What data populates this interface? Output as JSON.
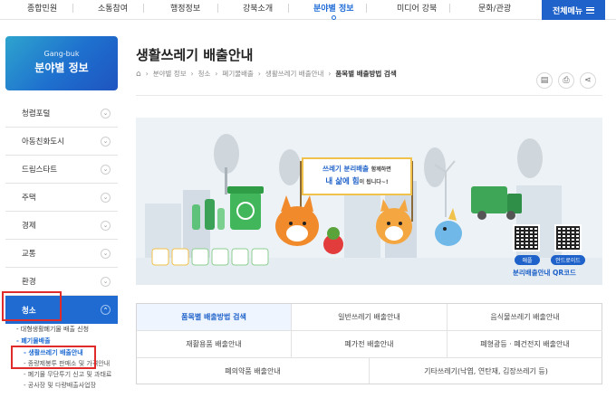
{
  "top_nav": {
    "items": [
      {
        "label": "종합민원"
      },
      {
        "label": "소통참여"
      },
      {
        "label": "행정정보"
      },
      {
        "label": "강북소개"
      },
      {
        "label": "분야별 정보"
      },
      {
        "label": "미디어 강북"
      },
      {
        "label": "문화/관광"
      }
    ],
    "active_index": 4,
    "all_menu_label": "전체메뉴"
  },
  "sidebar": {
    "banner_en": "Gang-buk",
    "banner_ko": "분야별 정보",
    "items": [
      {
        "label": "청렴포털"
      },
      {
        "label": "아동친화도시"
      },
      {
        "label": "드림스타트"
      },
      {
        "label": "주택"
      },
      {
        "label": "경제"
      },
      {
        "label": "교통"
      },
      {
        "label": "환경"
      },
      {
        "label": "청소"
      }
    ],
    "sub_items": [
      {
        "label": "- 대형생활폐기물 배출 신청",
        "level": 1
      },
      {
        "label": "- 폐기물배출",
        "level": 1
      },
      {
        "label": "- 생활쓰레기 배출안내",
        "level": 2
      },
      {
        "label": "- 종량제봉투 판매소 및 가격안내",
        "level": 2
      },
      {
        "label": "- 폐기물 무단투기 신고 및 과태료",
        "level": 2
      },
      {
        "label": "- 공사장 및 다량배출사업장",
        "level": 2
      }
    ]
  },
  "main": {
    "title": "생활쓰레기 배출안내",
    "breadcrumb": [
      "분야별 정보",
      "청소",
      "폐기물배출",
      "생활쓰레기 배출안내",
      "품목별 배출방법 검색"
    ]
  },
  "banner": {
    "sign_line1": "쓰레기 분리배출",
    "sign_line1_suffix": "함께하면",
    "sign_line2": "내 삶에 힘",
    "sign_line2_suffix": "이 됩니다~!",
    "qr_ios": "애플",
    "qr_android": "안드로이드",
    "qr_caption": "분리배출안내 QR코드"
  },
  "tabs": [
    {
      "label": "품목별 배출방법 검색"
    },
    {
      "label": "일반쓰레기 배출안내"
    },
    {
      "label": "음식물쓰레기 배출안내"
    },
    {
      "label": "재활용품 배출안내"
    },
    {
      "label": "폐가전 배출안내"
    },
    {
      "label": "폐형광등 · 폐건전지 배출안내"
    },
    {
      "label": "폐의약품 배출안내"
    },
    {
      "label": "기타쓰레기(낙엽, 연탄재, 김장쓰레기 등)"
    }
  ],
  "colors": {
    "accent": "#1f62c9",
    "highlight": "#e02b2b",
    "banner_bg": "#edf2f6"
  }
}
